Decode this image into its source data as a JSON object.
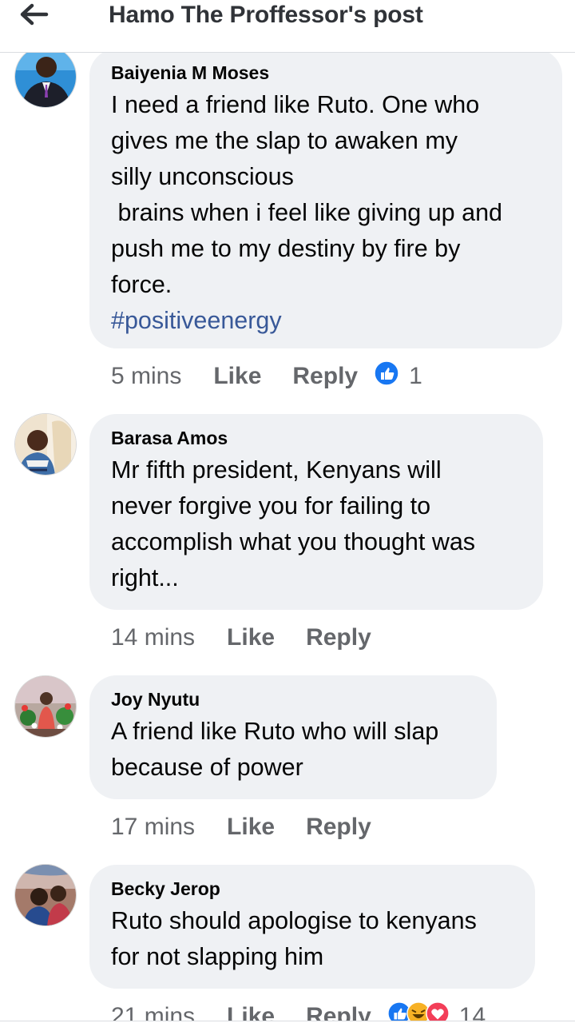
{
  "header": {
    "title": "Hamo The Proffessor's post",
    "back_icon": "back-arrow-icon"
  },
  "comments": [
    {
      "author": "Baiyenia M Moses",
      "text": "I need a friend like Ruto. One who\ngives me the slap to awaken my\nsilly unconscious\n brains when i feel like giving up and\npush me to my destiny by fire by\nforce.",
      "hashtag": "#positiveenergy",
      "time": "5 mins",
      "like_label": "Like",
      "reply_label": "Reply",
      "reaction_count": "1",
      "reactions": [
        "like-reaction-icon"
      ]
    },
    {
      "author": "Barasa Amos",
      "text": "Mr fifth president, Kenyans will\nnever forgive you for failing to\naccomplish what you thought was\nright...",
      "time": "14 mins",
      "like_label": "Like",
      "reply_label": "Reply"
    },
    {
      "author": "Joy Nyutu",
      "text": "A friend like Ruto who will slap\nbecause of power",
      "time": "17 mins",
      "like_label": "Like",
      "reply_label": "Reply"
    },
    {
      "author": "Becky Jerop",
      "text": "Ruto should apologise to kenyans\nfor not slapping him",
      "time": "21 mins",
      "like_label": "Like",
      "reply_label": "Reply",
      "reaction_count": "14",
      "reactions": [
        "like-reaction-icon",
        "haha-reaction-icon",
        "love-reaction-icon"
      ]
    }
  ],
  "colors": {
    "bubble": "#eff1f4",
    "hashtag": "#385898",
    "meta": "#65676b",
    "like_blue": "#1877f2",
    "love_red": "#f33e58",
    "haha_yellow": "#f7b125"
  }
}
